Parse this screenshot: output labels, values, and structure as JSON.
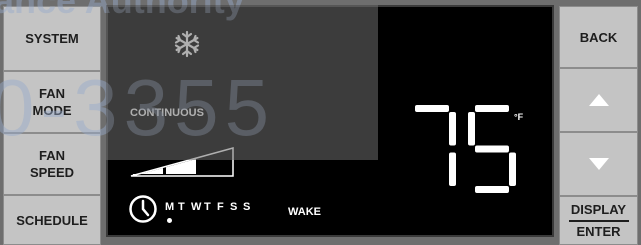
{
  "left_buttons": [
    {
      "label": "SYSTEM"
    },
    {
      "label": "FAN\nMODE"
    },
    {
      "label": "FAN\nSPEED"
    },
    {
      "label": "SCHEDULE"
    }
  ],
  "right_buttons": {
    "back": "BACK",
    "up_icon": "up-arrow-icon",
    "down_icon": "down-arrow-icon",
    "display": "DISPLAY",
    "enter": "ENTER"
  },
  "display": {
    "mode_icon": "snowflake-icon",
    "fan_mode": "CONTINUOUS",
    "temperature": "75",
    "unit": "°F",
    "fan_speed_level": 2,
    "fan_speed_max": 3,
    "days": [
      "M",
      "T",
      "W",
      "T",
      "F",
      "S",
      "S"
    ],
    "active_day_index": 0,
    "period": "WAKE"
  },
  "watermark": {
    "line1": "ance Authority",
    "line2": "0-3355"
  },
  "colors": {
    "screen": "#000000",
    "segment": "#ffffff",
    "button": "#c4c4c4",
    "bezel": "#6e6e6e"
  }
}
